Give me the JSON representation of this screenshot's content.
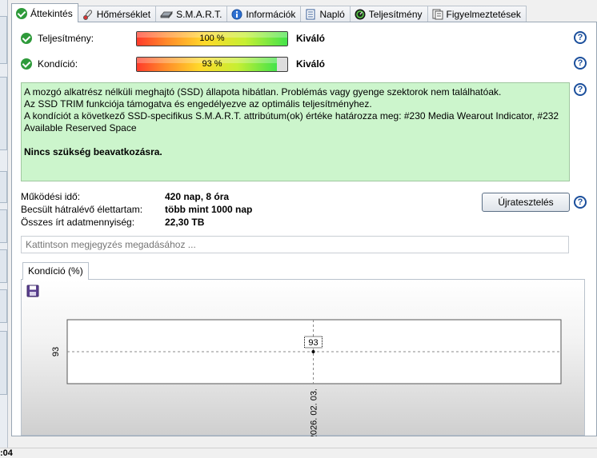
{
  "tabs": [
    {
      "label": "Áttekintés",
      "icon": "check-icon",
      "active": true
    },
    {
      "label": "Hőmérséklet",
      "icon": "thermometer-icon",
      "active": false
    },
    {
      "label": "S.M.A.R.T.",
      "icon": "drive-icon",
      "active": false
    },
    {
      "label": "Információk",
      "icon": "info-icon",
      "active": false
    },
    {
      "label": "Napló",
      "icon": "log-icon",
      "active": false
    },
    {
      "label": "Teljesítmény",
      "icon": "gauge-icon",
      "active": false
    },
    {
      "label": "Figyelmeztetések",
      "icon": "warning-doc-icon",
      "active": false
    }
  ],
  "performance": {
    "label": "Teljesítmény:",
    "value_text": "100 %",
    "fraction": 1.0,
    "rating": "Kiváló"
  },
  "health": {
    "label": "Kondíció:",
    "value_text": "93 %",
    "fraction": 0.93,
    "rating": "Kiváló"
  },
  "info": {
    "lines": [
      "A mozgó alkatrész nélküli meghajtó (SSD) állapota hibátlan. Problémás vagy gyenge szektorok nem találhatóak.",
      "Az SSD TRIM funkciója támogatva és engedélyezve az optimális teljesítményhez.",
      "A kondíciót a következő SSD-specifikus S.M.A.R.T. attribútum(ok) értéke határozza meg:  #230 Media Wearout Indicator, #232 Available Reserved Space"
    ],
    "conclusion": "Nincs szükség beavatkozásra."
  },
  "stats": [
    {
      "label": "Működési idő:",
      "value": "420 nap, 8 óra"
    },
    {
      "label": "Becsült hátralévő élettartam:",
      "value": "több mint 1000 nap"
    },
    {
      "label": "Összes írt adatmennyiség:",
      "value": "22,30 TB"
    }
  ],
  "retest_label": "Újratesztelés",
  "note_placeholder": "Kattintson megjegyzés megadásához ...",
  "chart_tab_label": "Kondíció  (%)",
  "status_fragment": ":04",
  "colors": {
    "accent": "#1b4f9c",
    "info_bg": "#ccf5cc",
    "ok_green": "#2e9a3a"
  },
  "chart_data": {
    "type": "line",
    "x": [
      "2026. 02. 03."
    ],
    "series": [
      {
        "values": [
          93
        ]
      }
    ],
    "ylim": [
      92,
      94
    ],
    "data_labels": [
      "93"
    ],
    "yticks": [
      "93"
    ],
    "grid": true
  }
}
